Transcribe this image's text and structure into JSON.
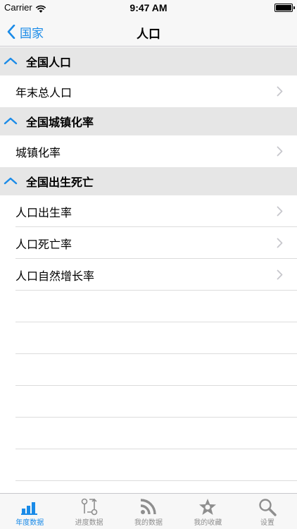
{
  "status_bar": {
    "carrier": "Carrier",
    "time": "9:47 AM"
  },
  "nav": {
    "back_label": "国家",
    "title": "人口"
  },
  "sections": [
    {
      "title": "全国人口",
      "items": [
        "年末总人口"
      ]
    },
    {
      "title": "全国城镇化率",
      "items": [
        "城镇化率"
      ]
    },
    {
      "title": "全国出生死亡",
      "items": [
        "人口出生率",
        "人口死亡率",
        "人口自然增长率"
      ]
    }
  ],
  "tabs": [
    {
      "label": "年度数据",
      "icon": "bar-chart-icon",
      "active": true
    },
    {
      "label": "进度数据",
      "icon": "flow-icon",
      "active": false
    },
    {
      "label": "我的数据",
      "icon": "rss-icon",
      "active": false
    },
    {
      "label": "我的收藏",
      "icon": "star-icon",
      "active": false
    },
    {
      "label": "设置",
      "icon": "search-icon",
      "active": false
    }
  ],
  "colors": {
    "accent": "#1a8be8",
    "section_bg": "#e6e6e6",
    "bar_bg": "#f7f7f7",
    "inactive": "#8e8e8e"
  }
}
